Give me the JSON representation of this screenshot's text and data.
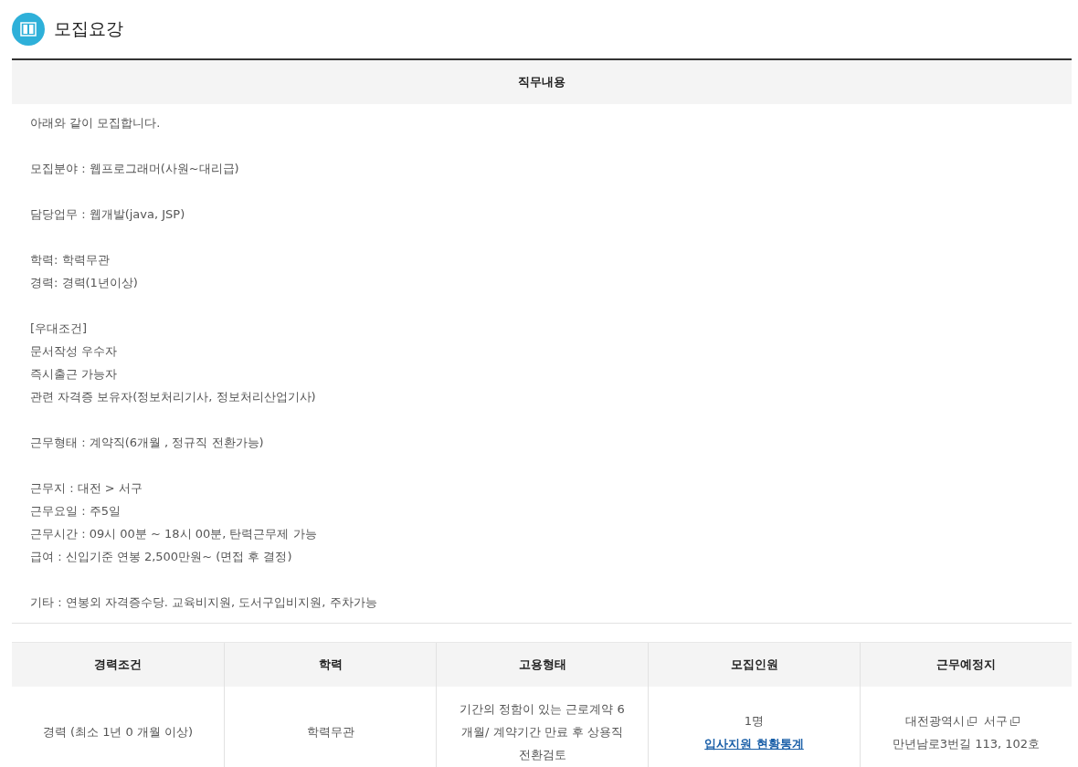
{
  "section": {
    "title": "모집요강"
  },
  "job_description": {
    "heading": "직무내용",
    "paragraphs": [
      [
        "아래와 같이 모집합니다."
      ],
      [
        "모집분야 : 웹프로그래머(사원~대리급)"
      ],
      [
        "담당업무 : 웹개발(java, JSP)"
      ],
      [
        "학력: 학력무관",
        "경력: 경력(1년이상)"
      ],
      [
        "[우대조건]",
        "문서작성 우수자",
        "즉시출근 가능자",
        "관련 자격증 보유자(정보처리기사, 정보처리산업기사)"
      ],
      [
        "근무형태 : 계약직(6개월 , 정규직 전환가능)"
      ],
      [
        "근무지 : 대전 > 서구",
        "근무요일 : 주5일",
        "근무시간 : 09시 00분 ~ 18시 00분, 탄력근무제 가능",
        "급여 : 신입기준 연봉 2,500만원~ (면접 후 결정)"
      ],
      [
        "기타 : 연봉외 자격증수당. 교육비지원, 도서구입비지원, 주차가능"
      ]
    ]
  },
  "table": {
    "columns": [
      "경력조건",
      "학력",
      "고용형태",
      "모집인원",
      "근무예정지"
    ],
    "row": {
      "experience": "경력 (최소 1년 0 개월 이상)",
      "education": "학력무관",
      "employment": "기간의 정함이 있는 근로계약 6개월/ 계약기간 만료 후 상용직 전환검토",
      "headcount": "1명",
      "stats_link": "입사지원 현황통계",
      "location": [
        {
          "text": "대전광역시",
          "link": true
        },
        {
          "text": "서구",
          "link": true
        },
        {
          "text": "만년남로3번길 113, 102호",
          "link": false
        }
      ]
    }
  }
}
